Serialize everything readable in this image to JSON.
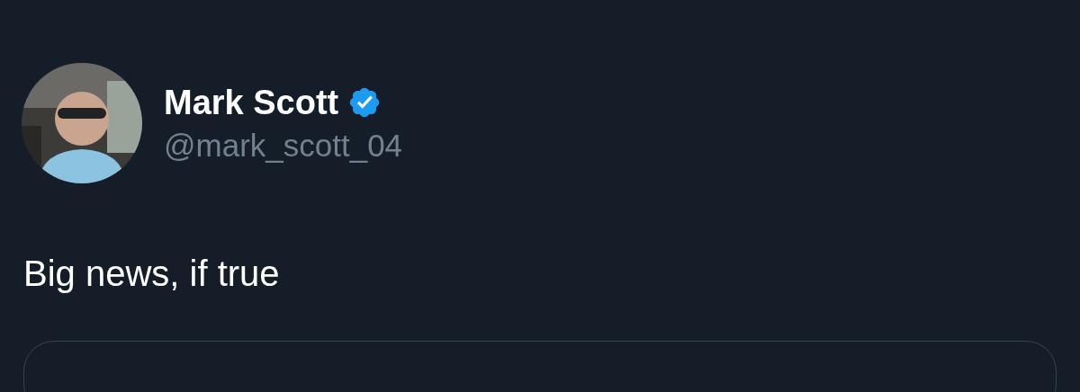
{
  "post": {
    "author": {
      "name": "Mark Scott",
      "verified": true,
      "handle": "@mark_scott_04"
    },
    "text": "Big news, if true",
    "embed": {
      "kind": "card"
    }
  }
}
